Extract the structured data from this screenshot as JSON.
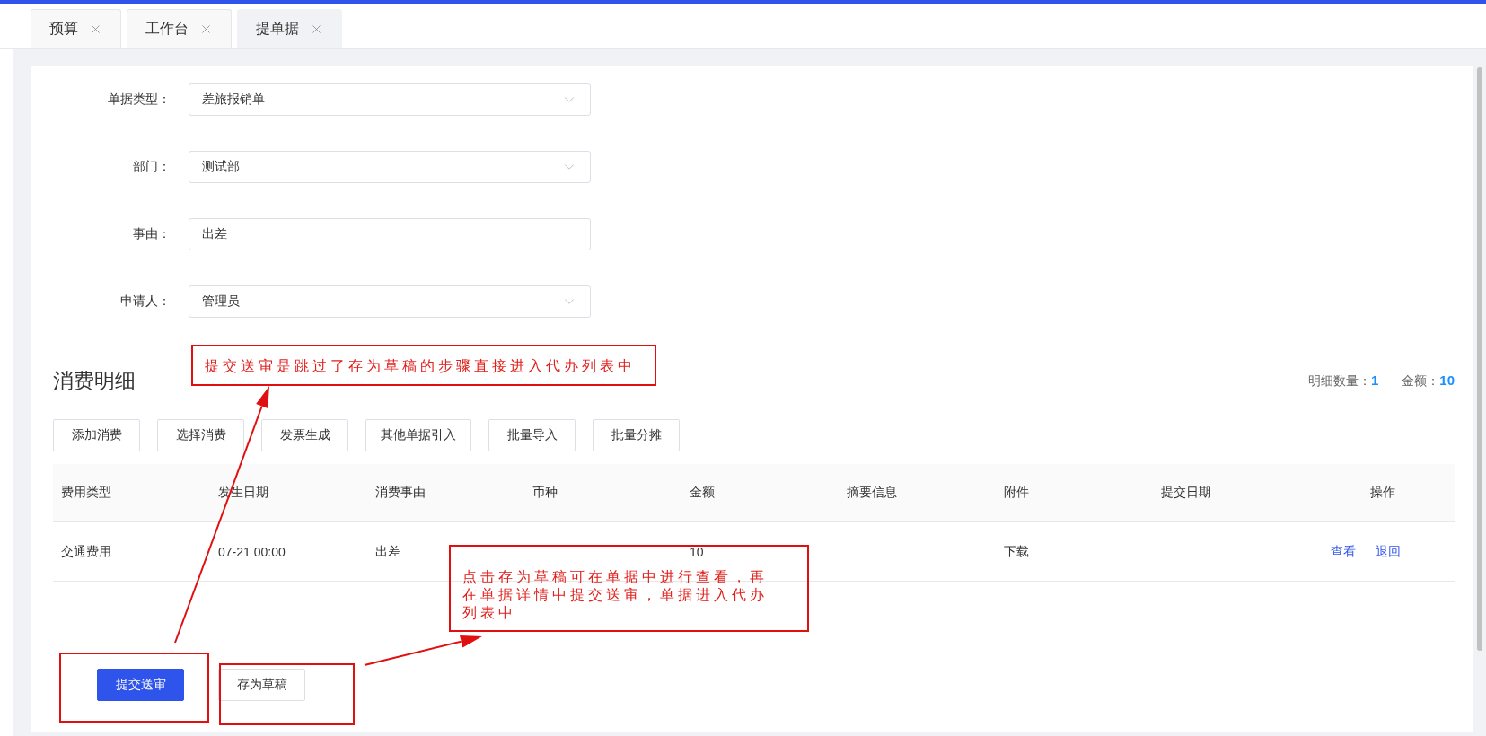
{
  "tabs": [
    {
      "label": "预算",
      "selected": false
    },
    {
      "label": "工作台",
      "selected": false
    },
    {
      "label": "提单据",
      "selected": true
    }
  ],
  "form": {
    "fields": [
      {
        "label": "单据类型：",
        "value": "差旅报销单",
        "kind": "select"
      },
      {
        "label": "部门：",
        "value": "测试部",
        "kind": "select"
      },
      {
        "label": "事由：",
        "value": "出差",
        "kind": "input"
      },
      {
        "label": "申请人：",
        "value": "管理员",
        "kind": "select"
      }
    ]
  },
  "section": {
    "title": "消费明细",
    "summary": [
      {
        "label": "明细数量：",
        "value": "1"
      },
      {
        "label": "金额：",
        "value": "10"
      }
    ]
  },
  "toolbar": [
    "添加消费",
    "选择消费",
    "发票生成",
    "其他单据引入",
    "批量导入",
    "批量分摊"
  ],
  "table": {
    "columns": [
      "费用类型",
      "发生日期",
      "消费事由",
      "币种",
      "金额",
      "摘要信息",
      "附件",
      "提交日期",
      "操作"
    ],
    "rows": [
      {
        "cells": [
          "交通费用",
          "07-21 00:00",
          "出差",
          null,
          "10",
          null,
          "下载",
          null
        ],
        "actions": [
          "查看",
          "退回"
        ]
      }
    ]
  },
  "footer_buttons": [
    {
      "label": "提交送审",
      "kind": "primary"
    },
    {
      "label": "存为草稿",
      "kind": "default"
    }
  ],
  "annotations": [
    {
      "kind": "note",
      "text": "提交送审是跳过了存为草稿的步骤直接进入代办列表中"
    },
    {
      "kind": "note",
      "text": "点击存为草稿可在单据中进行查看，再在单据详情中提交送审，单据进入代办列表中"
    },
    {
      "kind": "frame"
    },
    {
      "kind": "frame"
    },
    {
      "kind": "arrow"
    },
    {
      "kind": "arrow"
    }
  ]
}
